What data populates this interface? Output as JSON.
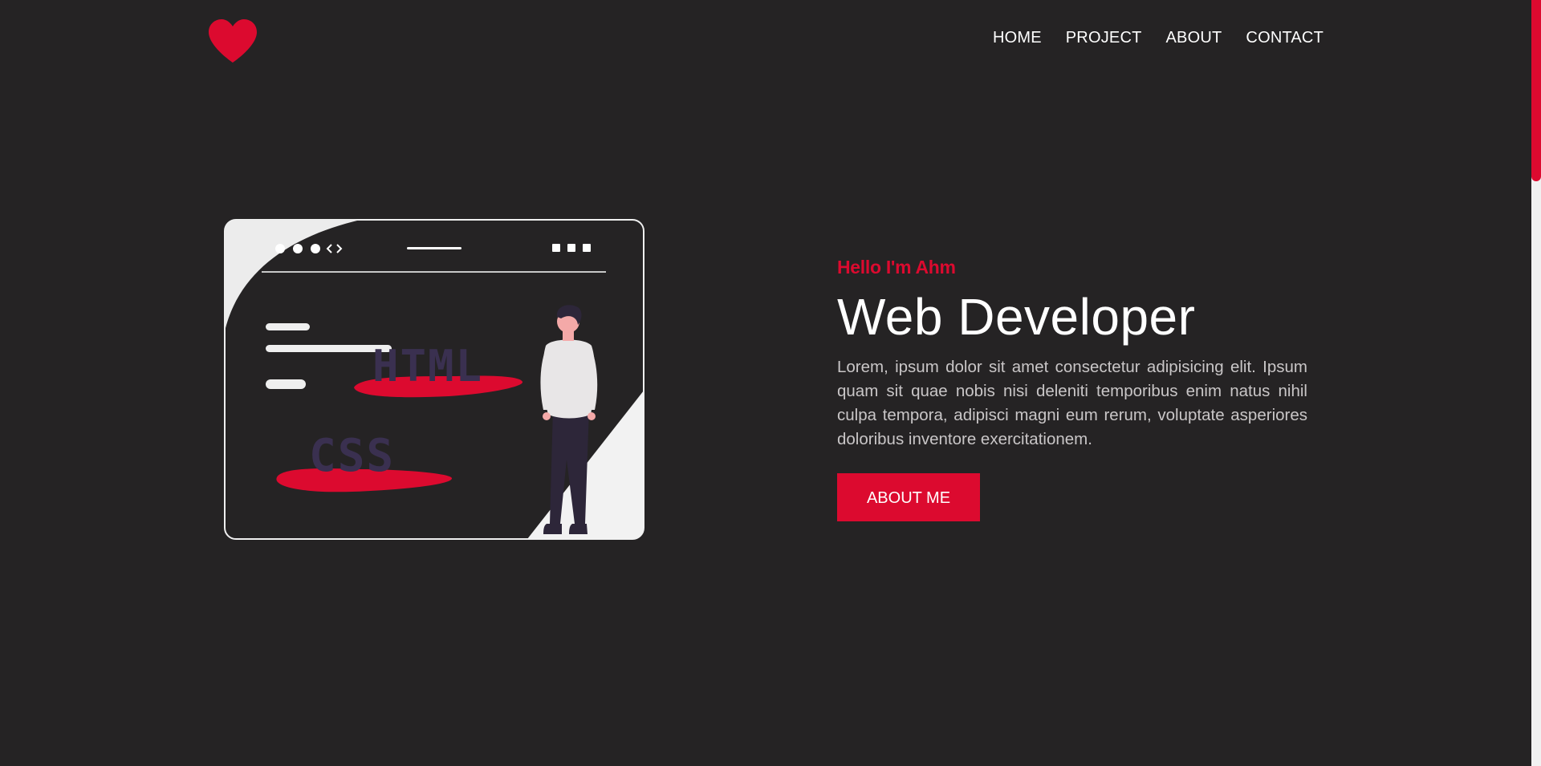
{
  "header": {
    "logo": "heart-logo",
    "nav": [
      {
        "label": "HOME"
      },
      {
        "label": "PROJECT"
      },
      {
        "label": "ABOUT"
      },
      {
        "label": "CONTACT"
      }
    ]
  },
  "hero": {
    "greeting": "Hello I'm Ahm",
    "title": "Web Developer",
    "description": "Lorem, ipsum dolor sit amet consectetur adipisicing elit. Ipsum quam sit quae nobis nisi deleniti temporibus enim natus nihil culpa tempora, adipisci magni eum rerum, voluptate asperiores doloribus inventore exercitationem.",
    "button_label": "ABOUT ME"
  },
  "illustration": {
    "html_label": "HTML",
    "css_label": "CSS"
  },
  "colors": {
    "background": "#252324",
    "accent": "#dc0a2f",
    "text": "#ffffff",
    "muted_text": "#c9c6c7",
    "illustration_purple": "#3a3050"
  }
}
